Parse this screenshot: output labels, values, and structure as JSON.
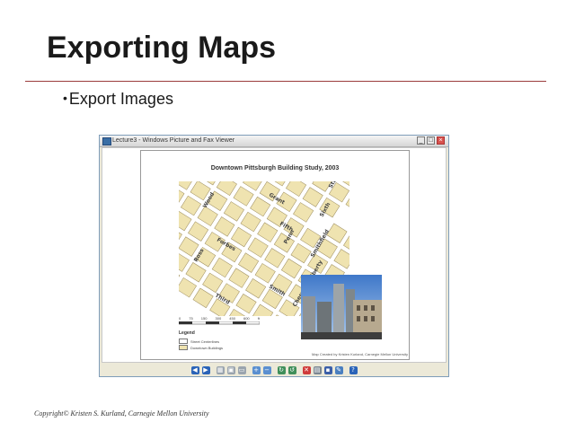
{
  "slide": {
    "title": "Exporting Maps",
    "bullet": "Export Images",
    "footer": "Copyright© Kristen S. Kurland, Carnegie Mellon University"
  },
  "window": {
    "title": "Lecture3 - Windows Picture and Fax Viewer",
    "buttons": {
      "minimize": "_",
      "maximize": "□",
      "close": "×"
    }
  },
  "map": {
    "title": "Downtown Pittsburgh Building Study, 2003",
    "street_labels": [
      "Grant",
      "Stanwix",
      "Fifth",
      "Forbes",
      "Wood",
      "Smith",
      "Liberty",
      "Penn",
      "Sixth",
      "Third",
      "Ross",
      "Smithfield",
      "Cherry"
    ],
    "scale_labels": [
      "0",
      "75",
      "150",
      "300",
      "450",
      "600"
    ],
    "scale_unit": "ft",
    "legend_title": "Legend",
    "legend_items": [
      {
        "label": "Street Centerlines",
        "color": "#ffffff"
      },
      {
        "label": "Downtown Buildings",
        "color": "#efe3b0"
      }
    ],
    "credit": "Map Created by Kristen Kurland, Carnegie Mellon University"
  },
  "colors": {
    "building_fill": "#efe3b0",
    "building_stroke": "#9a8a5a",
    "street": "#ffffff",
    "title_rule": "#9a3b3b"
  },
  "toolbar_icons": [
    "previous-image-icon",
    "next-image-icon",
    "best-fit-icon",
    "actual-size-icon",
    "slideshow-icon",
    "zoom-in-icon",
    "zoom-out-icon",
    "rotate-clockwise-icon",
    "rotate-counterclockwise-icon",
    "delete-icon",
    "print-icon",
    "save-icon",
    "open-editor-icon",
    "help-icon"
  ]
}
